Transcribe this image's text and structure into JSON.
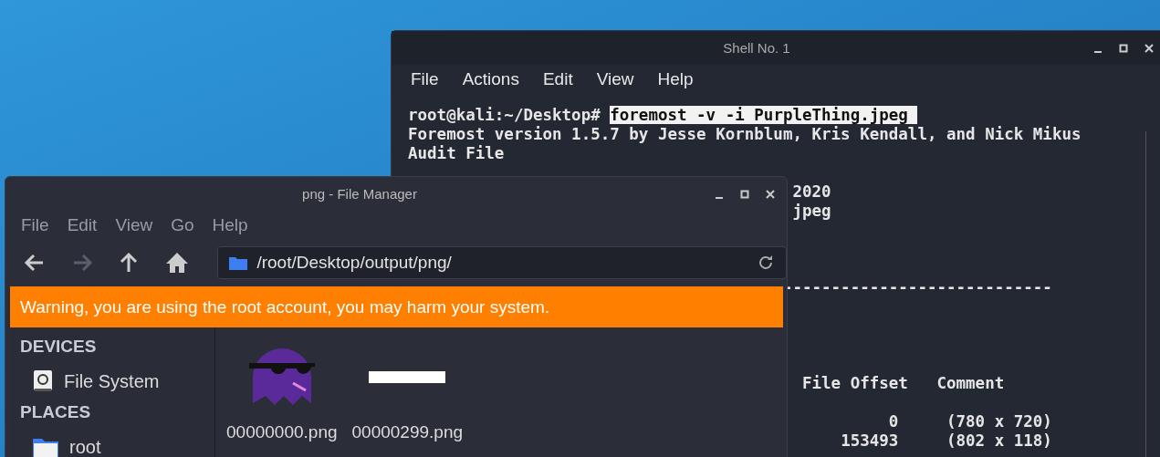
{
  "terminal": {
    "title": "Shell No. 1",
    "menu": [
      "File",
      "Actions",
      "Edit",
      "View",
      "Help"
    ],
    "prompt": "root@kali:~/Desktop#",
    "command": "foremost -v -i PurpleThing.jpeg",
    "command_selected": true,
    "output": [
      "Foremost version 1.5.7 by Jesse Kornblum, Kris Kendall, and Nick Mikus",
      "Audit File"
    ],
    "fragments": [
      "2020",
      "jpeg"
    ],
    "rule": "----------------------------",
    "table": {
      "columns": [
        "File Offset",
        "Comment"
      ],
      "rows": [
        [
          "0",
          "(780 x 720)"
        ],
        [
          "153493",
          "(802 x 118)"
        ]
      ]
    }
  },
  "file_manager": {
    "title": "png - File Manager",
    "menu": [
      "File",
      "Edit",
      "View",
      "Go",
      "Help"
    ],
    "toolbar": [
      {
        "kind": "back",
        "disabled": false
      },
      {
        "kind": "forward",
        "disabled": true
      },
      {
        "kind": "up",
        "disabled": false
      },
      {
        "kind": "home",
        "disabled": false
      }
    ],
    "location": "/root/Desktop/output/png/",
    "warning": "Warning, you are using the root account, you may harm your system.",
    "sidebar": [
      {
        "heading": "DEVICES",
        "items": [
          {
            "kind": "drive",
            "label": "File System"
          }
        ]
      },
      {
        "heading": "PLACES",
        "items": [
          {
            "kind": "folder",
            "label": "root"
          }
        ]
      }
    ],
    "files": [
      {
        "kind": "ghost",
        "name": "00000000.png"
      },
      {
        "kind": "strip",
        "name": "00000299.png"
      }
    ]
  }
}
